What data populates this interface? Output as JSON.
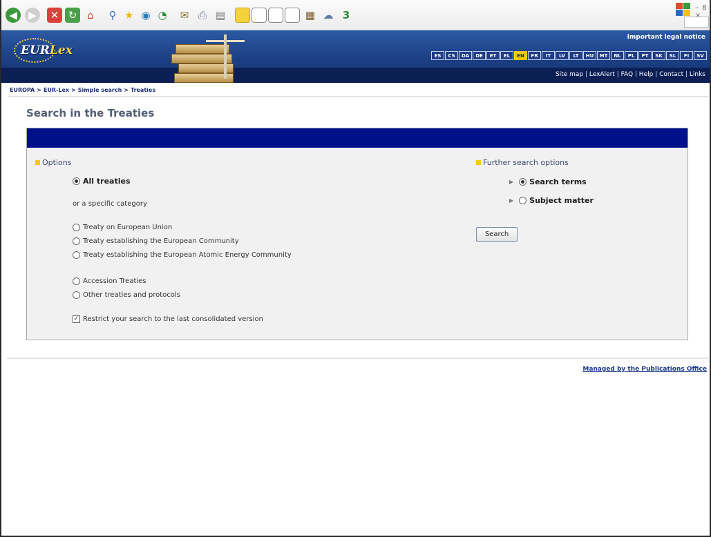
{
  "toolbar": {
    "icons": [
      "back-icon",
      "forward-icon",
      "stop-icon",
      "refresh-icon",
      "home-icon",
      "search-icon",
      "favorites-icon",
      "media-icon",
      "history-icon",
      "mail-icon",
      "print-icon",
      "edit-icon",
      "note-icon",
      "page-icon",
      "page-icon",
      "page-icon",
      "research-icon",
      "messenger-icon",
      "tool-icon"
    ],
    "window_controls": "– 8 ×"
  },
  "banner": {
    "logo_text_a": "EUR",
    "logo_text_b": "Lex",
    "legal_notice": "Important legal notice",
    "languages": [
      "ES",
      "CS",
      "DA",
      "DE",
      "ET",
      "EL",
      "EN",
      "FR",
      "IT",
      "LV",
      "LT",
      "HU",
      "MT",
      "NL",
      "PL",
      "PT",
      "SK",
      "SL",
      "FI",
      "SV"
    ],
    "active_language": "EN",
    "top_links": [
      "Site map",
      "LexAlert",
      "FAQ",
      "Help",
      "Contact",
      "Links"
    ]
  },
  "breadcrumb": [
    "EUROPA",
    "EUR-Lex",
    "Simple search",
    "Treaties"
  ],
  "page": {
    "title": "Search in the Treaties"
  },
  "options": {
    "heading": "Options",
    "all_treaties": "All treaties",
    "specific_category": "or a specific category",
    "categories": [
      "Treaty on European Union",
      "Treaty establishing the European Community",
      "Treaty establishing the European Atomic Energy Community"
    ],
    "other_categories": [
      "Accession Treaties",
      "Other treaties and protocols"
    ],
    "restrict_label": "Restrict your search to the last consolidated version",
    "restrict_checked": true
  },
  "further": {
    "heading": "Further search options",
    "search_terms": "Search terms",
    "subject_matter": "Subject matter",
    "search_button": "Search"
  },
  "footer": {
    "managed_by": "Managed by the Publications Office"
  },
  "colors": {
    "banner": "#1b3f84",
    "panel_header": "#00108a",
    "bullet": "#f2c913",
    "active_language": "#f5c518"
  }
}
